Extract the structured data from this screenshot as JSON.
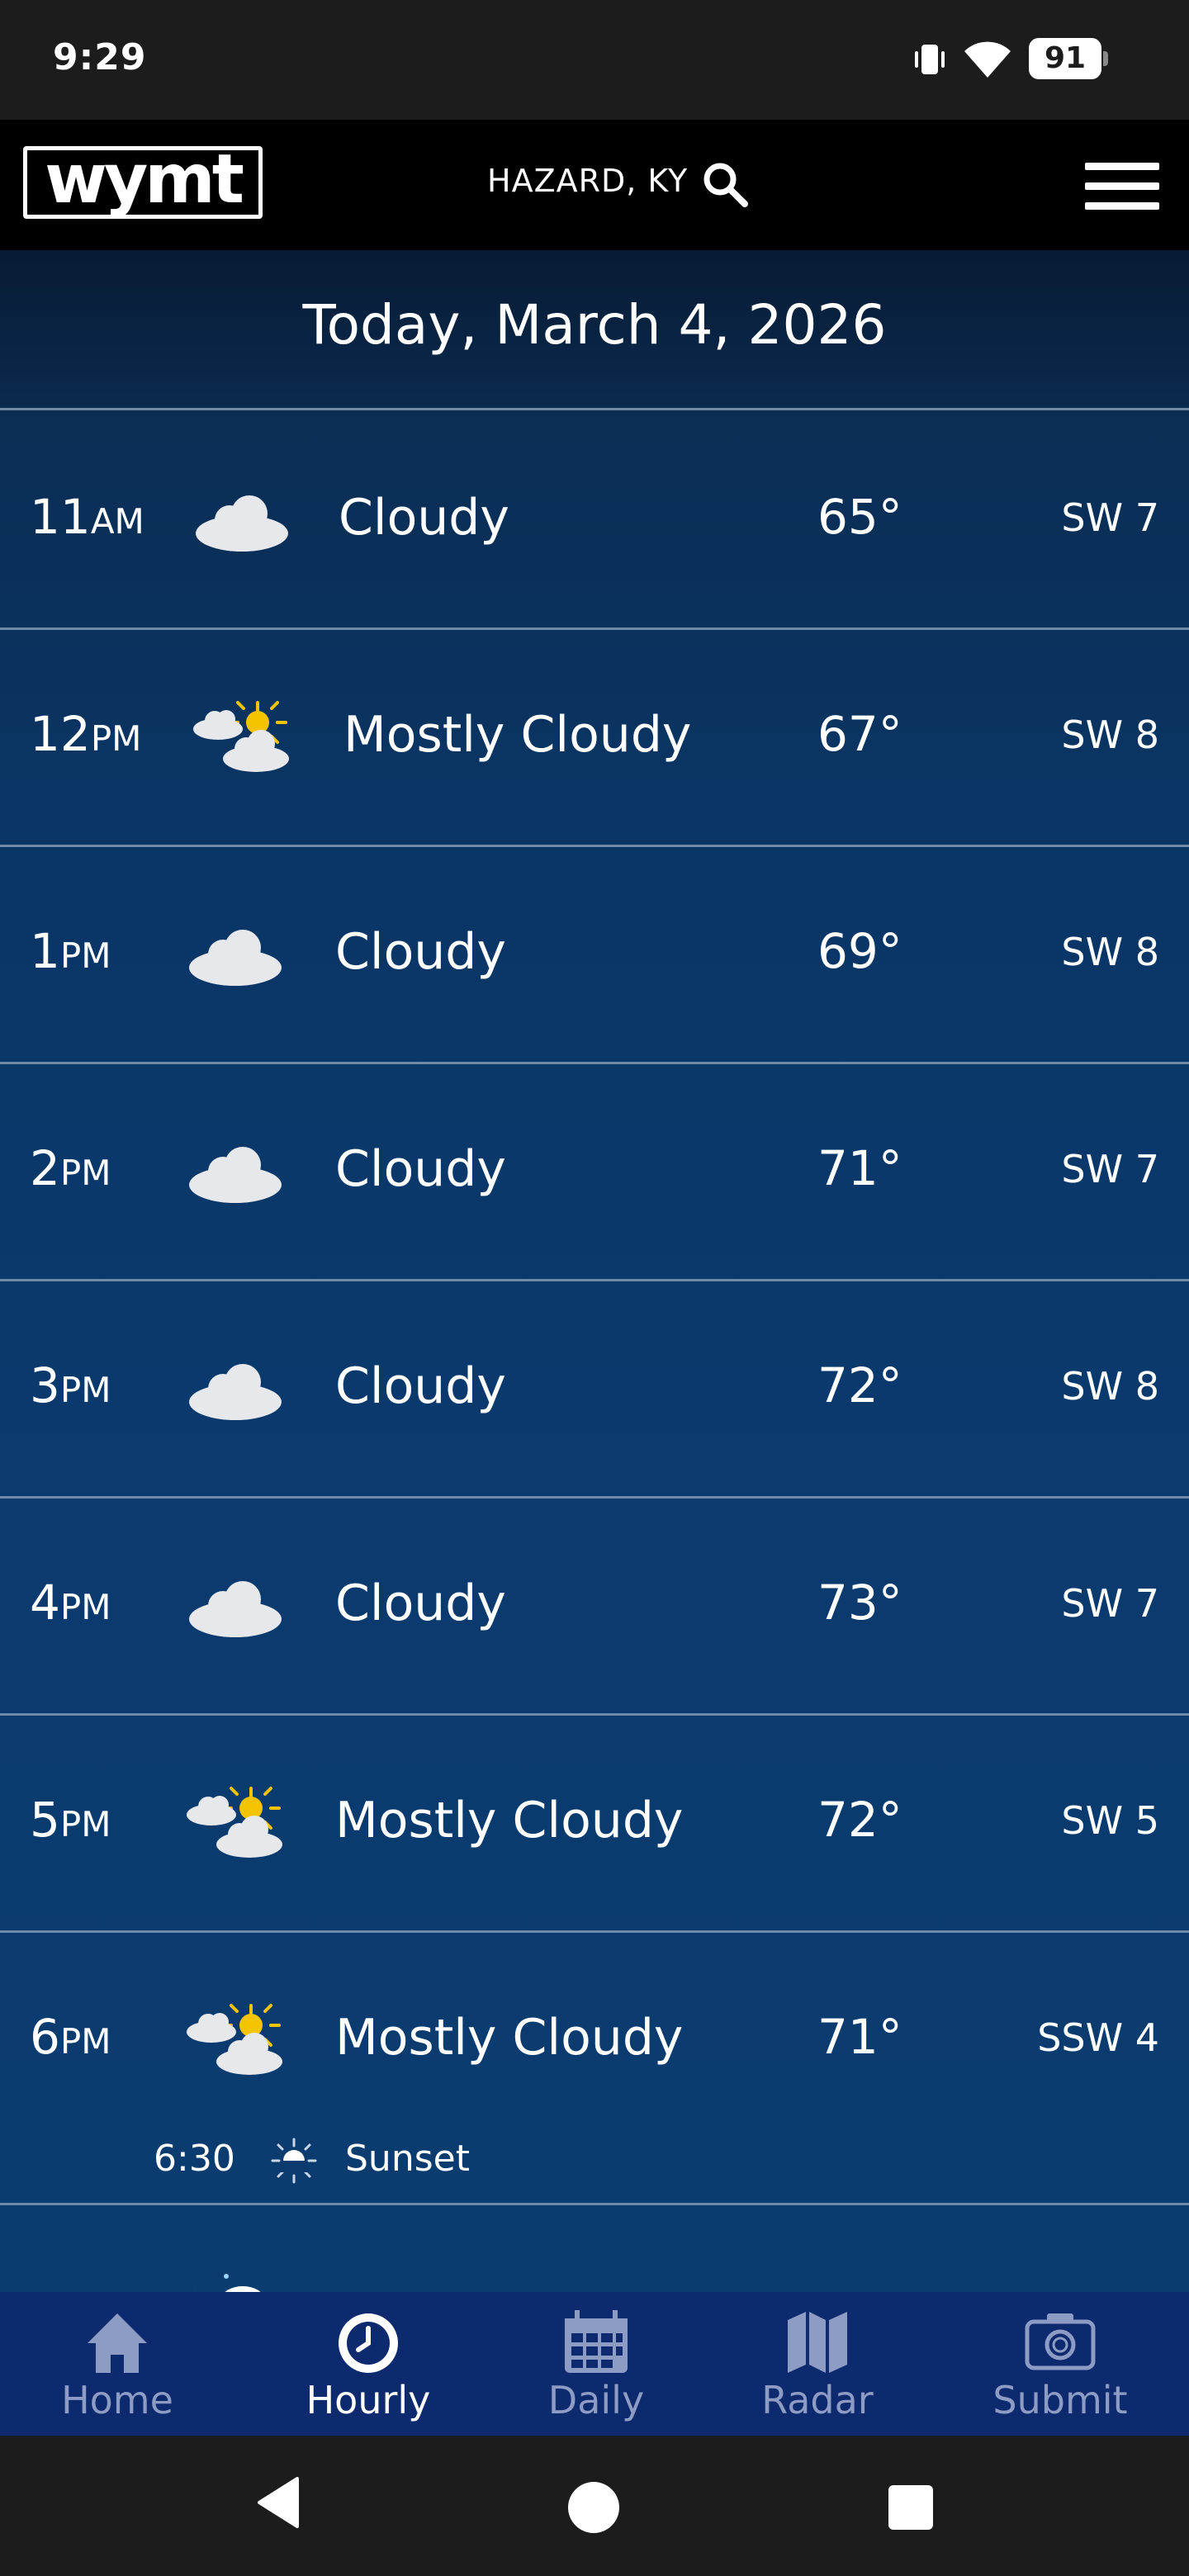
{
  "status_bar": {
    "time": "9:29",
    "battery": "91"
  },
  "header": {
    "logo": "wymt",
    "location": "HAZARD, KY"
  },
  "date_header": "Today, March 4, 2026",
  "hours": [
    {
      "hour": "11",
      "ampm": "AM",
      "icon": "cloud-icon",
      "condition": "Cloudy",
      "temp": "65°",
      "wind": "SW 7"
    },
    {
      "hour": "12",
      "ampm": "PM",
      "icon": "partly-sunny-icon",
      "condition": "Mostly Cloudy",
      "temp": "67°",
      "wind": "SW 8"
    },
    {
      "hour": "1",
      "ampm": "PM",
      "icon": "cloud-icon",
      "condition": "Cloudy",
      "temp": "69°",
      "wind": "SW 8"
    },
    {
      "hour": "2",
      "ampm": "PM",
      "icon": "cloud-icon",
      "condition": "Cloudy",
      "temp": "71°",
      "wind": "SW 7"
    },
    {
      "hour": "3",
      "ampm": "PM",
      "icon": "cloud-icon",
      "condition": "Cloudy",
      "temp": "72°",
      "wind": "SW 8"
    },
    {
      "hour": "4",
      "ampm": "PM",
      "icon": "cloud-icon",
      "condition": "Cloudy",
      "temp": "73°",
      "wind": "SW 7"
    },
    {
      "hour": "5",
      "ampm": "PM",
      "icon": "partly-sunny-icon",
      "condition": "Mostly Cloudy",
      "temp": "72°",
      "wind": "SW 5"
    },
    {
      "hour": "6",
      "ampm": "PM",
      "icon": "partly-sunny-icon",
      "condition": "Mostly Cloudy",
      "temp": "71°",
      "wind": "SSW 4"
    }
  ],
  "sunset": {
    "time": "6:30",
    "label": "Sunset"
  },
  "bottom_nav": [
    {
      "label": "Home",
      "icon": "home-icon",
      "active": false
    },
    {
      "label": "Hourly",
      "icon": "clock-icon",
      "active": true
    },
    {
      "label": "Daily",
      "icon": "calendar-icon",
      "active": false
    },
    {
      "label": "Radar",
      "icon": "map-icon",
      "active": false
    },
    {
      "label": "Submit",
      "icon": "camera-icon",
      "active": false
    }
  ],
  "colors": {
    "accent_nav": "#0d2a6e",
    "content_bg": "#0a3a6e",
    "divider": "#6f8aa6"
  }
}
